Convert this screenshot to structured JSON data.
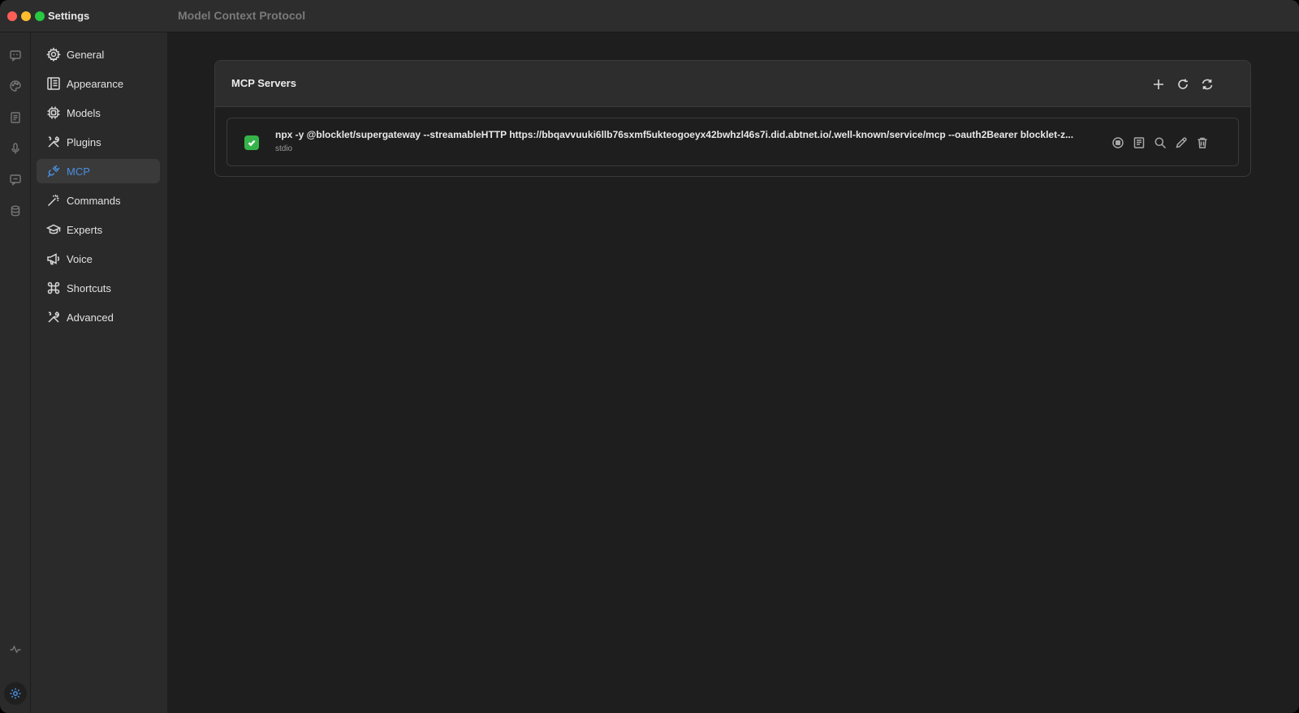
{
  "window": {
    "app_title": "Settings",
    "page_title": "Model Context Protocol"
  },
  "rail": {
    "icons": [
      "chat-bubble-icon",
      "palette-icon",
      "document-icon",
      "microphone-icon",
      "message-icon",
      "database-icon",
      "activity-icon",
      "settings-gear-icon"
    ]
  },
  "sidebar": {
    "items": [
      {
        "label": "General",
        "icon": "gear-icon"
      },
      {
        "label": "Appearance",
        "icon": "layout-icon"
      },
      {
        "label": "Models",
        "icon": "chip-icon"
      },
      {
        "label": "Plugins",
        "icon": "tools-icon"
      },
      {
        "label": "MCP",
        "icon": "plug-icon",
        "active": true
      },
      {
        "label": "Commands",
        "icon": "wand-icon"
      },
      {
        "label": "Experts",
        "icon": "graduation-cap-icon"
      },
      {
        "label": "Voice",
        "icon": "megaphone-icon"
      },
      {
        "label": "Shortcuts",
        "icon": "command-icon"
      },
      {
        "label": "Advanced",
        "icon": "tools-icon"
      }
    ]
  },
  "mcp": {
    "section_title": "MCP Servers",
    "header_actions": [
      "add-icon",
      "reload-icon",
      "refresh-icon"
    ],
    "servers": [
      {
        "enabled": true,
        "command": "npx -y @blocklet/supergateway --streamableHTTP https://bbqavvuuki6llb76sxmf5ukteogoeyx42bwhzl46s7i.did.abtnet.io/.well-known/service/mcp --oauth2Bearer blocklet-z...",
        "type": "stdio",
        "actions": [
          "stop-icon",
          "logs-icon",
          "inspect-icon",
          "edit-icon",
          "delete-icon"
        ]
      }
    ]
  },
  "colors": {
    "accent": "#4a90e2",
    "enabled_check": "#35b34a",
    "window_bg": "#1e1e1e",
    "sidebar_bg": "#2a2a2a"
  }
}
